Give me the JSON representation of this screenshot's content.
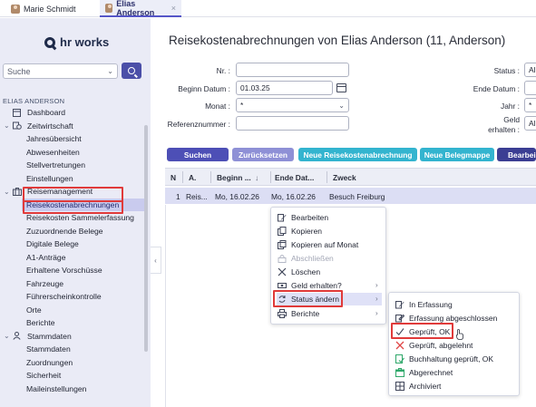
{
  "tabs": [
    {
      "label": "Marie Schmidt",
      "active": false
    },
    {
      "label": "Elias Anderson",
      "active": true,
      "close": "×"
    }
  ],
  "brand": {
    "name": "hr works"
  },
  "sidebar": {
    "search_placeholder": "Suche",
    "user_heading": "ELIAS ANDERSON",
    "items": [
      {
        "label": "Dashboard",
        "level": 0,
        "icon": "dashboard-icon"
      },
      {
        "label": "Zeitwirtschaft",
        "level": 0,
        "icon": "clock-icon",
        "expanded": true
      },
      {
        "label": "Jahresübersicht",
        "level": 1
      },
      {
        "label": "Abwesenheiten",
        "level": 1
      },
      {
        "label": "Stellvertretungen",
        "level": 1
      },
      {
        "label": "Einstellungen",
        "level": 1
      },
      {
        "label": "Reisemanagement",
        "level": 0,
        "icon": "suitcase-icon",
        "expanded": true
      },
      {
        "label": "Reisekostenabrechnungen",
        "level": 1,
        "selected": true
      },
      {
        "label": "Reisekosten Sammelerfassung",
        "level": 1
      },
      {
        "label": "Zuzuordnende Belege",
        "level": 1
      },
      {
        "label": "Digitale Belege",
        "level": 1
      },
      {
        "label": "A1-Anträge",
        "level": 1
      },
      {
        "label": "Erhaltene Vorschüsse",
        "level": 1
      },
      {
        "label": "Fahrzeuge",
        "level": 1
      },
      {
        "label": "Führerscheinkontrolle",
        "level": 1
      },
      {
        "label": "Orte",
        "level": 1
      },
      {
        "label": "Berichte",
        "level": 1
      },
      {
        "label": "Stammdaten",
        "level": 0,
        "icon": "person-icon",
        "expanded": true
      },
      {
        "label": "Stammdaten",
        "level": 1
      },
      {
        "label": "Zuordnungen",
        "level": 1
      },
      {
        "label": "Sicherheit",
        "level": 1
      },
      {
        "label": "Maileinstellungen",
        "level": 1
      }
    ]
  },
  "page": {
    "title": "Reisekostenabrechnungen von Elias Anderson (11, Anderson)"
  },
  "filters": {
    "nr_label": "Nr. :",
    "nr_value": "",
    "beginn_label": "Beginn Datum :",
    "beginn_value": "01.03.25",
    "monat_label": "Monat :",
    "monat_value": "*",
    "referenz_label": "Referenznummer :",
    "referenz_value": "",
    "status_label": "Status :",
    "status_value": "Al",
    "ende_label": "Ende Datum :",
    "jahr_label": "Jahr :",
    "jahr_value": "*",
    "geld_label_1": "Geld",
    "geld_label_2": "erhalten :",
    "geld_value": "Al"
  },
  "buttons": {
    "suchen": "Suchen",
    "zuruecksetzen": "Zurücksetzen",
    "neue_abrechnung": "Neue Reisekostenabrechnung",
    "neue_belegmappe": "Neue Belegmappe",
    "bearbeiten": "Bearbei"
  },
  "grid": {
    "columns": [
      "N",
      "A.",
      "Beginn ...",
      "Ende Dat...",
      "Zweck"
    ],
    "sort_indicator": "↓",
    "rows": [
      {
        "n": "1",
        "a": "Reis...",
        "beginn": "Mo, 16.02.26",
        "ende": "Mo, 16.02.26",
        "zweck": "Besuch Freiburg"
      }
    ]
  },
  "context_menu": {
    "items": [
      {
        "label": "Bearbeiten",
        "icon": "edit-icon",
        "enabled": true
      },
      {
        "label": "Kopieren",
        "icon": "copy-icon",
        "enabled": true
      },
      {
        "label": "Kopieren auf Monat",
        "icon": "copy-month-icon",
        "enabled": true
      },
      {
        "label": "Abschließen",
        "icon": "lock-icon",
        "enabled": false
      },
      {
        "label": "Löschen",
        "icon": "delete-icon",
        "enabled": true
      },
      {
        "label": "Geld erhalten?",
        "icon": "money-icon",
        "enabled": true,
        "submenu": true
      },
      {
        "label": "Status ändern",
        "icon": "status-icon",
        "enabled": true,
        "submenu": true,
        "highlighted": true
      },
      {
        "label": "Berichte",
        "icon": "print-icon",
        "enabled": true,
        "submenu": true
      }
    ]
  },
  "status_submenu": {
    "items": [
      {
        "label": "In Erfassung",
        "icon": "edit-icon"
      },
      {
        "label": "Erfassung abgeschlossen",
        "icon": "edit-lock-icon"
      },
      {
        "label": "Geprüft, OK",
        "icon": "check-icon",
        "highlighted": true
      },
      {
        "label": "Geprüft, abgelehnt",
        "icon": "reject-icon"
      },
      {
        "label": "Buchhaltung geprüft, OK",
        "icon": "accounting-check-icon"
      },
      {
        "label": "Abgerechnet",
        "icon": "settled-icon"
      },
      {
        "label": "Archiviert",
        "icon": "archive-icon"
      }
    ]
  },
  "colors": {
    "accent": "#4d4fb6",
    "teal": "#33b4cf",
    "highlight_box": "#e03a3a"
  }
}
